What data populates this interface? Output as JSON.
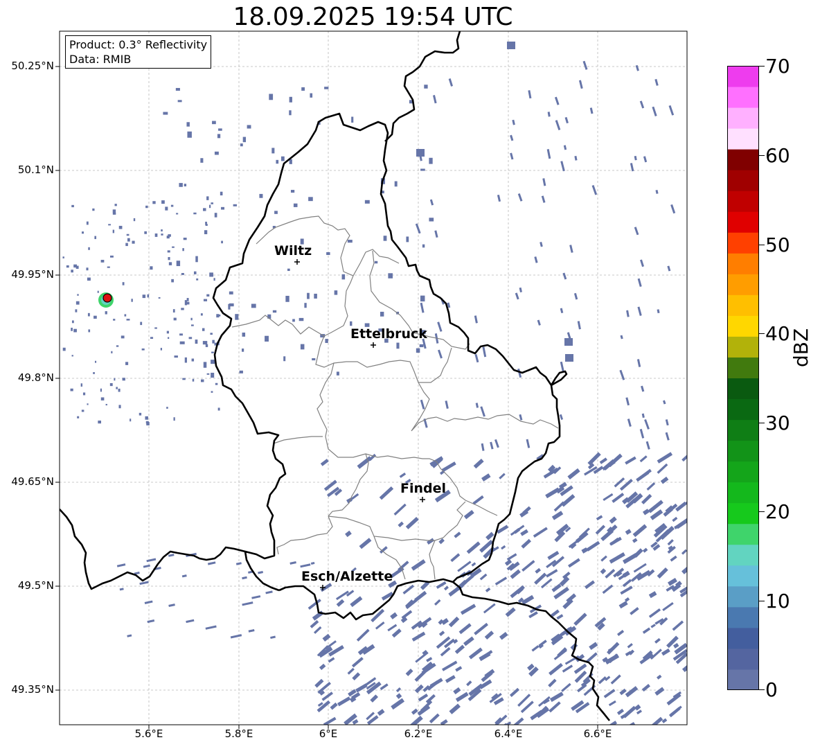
{
  "title": "18.09.2025 19:54 UTC",
  "info_box": {
    "product": "Product: 0.3° Reflectivity",
    "data_source": "Data: RMIB"
  },
  "y_ticks": [
    "50.25°N",
    "50.1°N",
    "49.95°N",
    "49.8°N",
    "49.65°N",
    "49.5°N",
    "49.35°N"
  ],
  "x_ticks": [
    "5.6°E",
    "5.8°E",
    "6°E",
    "6.2°E",
    "6.4°E",
    "6.6°E"
  ],
  "cities": [
    {
      "name": "Wiltz"
    },
    {
      "name": "Ettelbruck"
    },
    {
      "name": "Findel"
    },
    {
      "name": "Esch/Alzette"
    }
  ],
  "colorbar": {
    "label": "dBZ",
    "ticks": [
      "0",
      "10",
      "20",
      "30",
      "40",
      "50",
      "60",
      "70"
    ],
    "colors": [
      "#6675a8",
      "#5465a0",
      "#435e9e",
      "#4a79b0",
      "#5a9ec6",
      "#66c0da",
      "#62d4c0",
      "#3fd46b",
      "#16c91c",
      "#14b81c",
      "#14a51a",
      "#129318",
      "#0f7e15",
      "#0a6912",
      "#0a5a10",
      "#417a0e",
      "#b2b20a",
      "#ffd700",
      "#ffbf00",
      "#ff9d00",
      "#ff7e00",
      "#ff4000",
      "#e00000",
      "#c00000",
      "#a00000",
      "#800000",
      "#ffe0ff",
      "#ffb0ff",
      "#ff70ff",
      "#ee3cee"
    ]
  },
  "colors": {
    "echo": "#6675a8",
    "border": "#000000",
    "canton": "#808080",
    "radar_marker": "#dd1111"
  }
}
